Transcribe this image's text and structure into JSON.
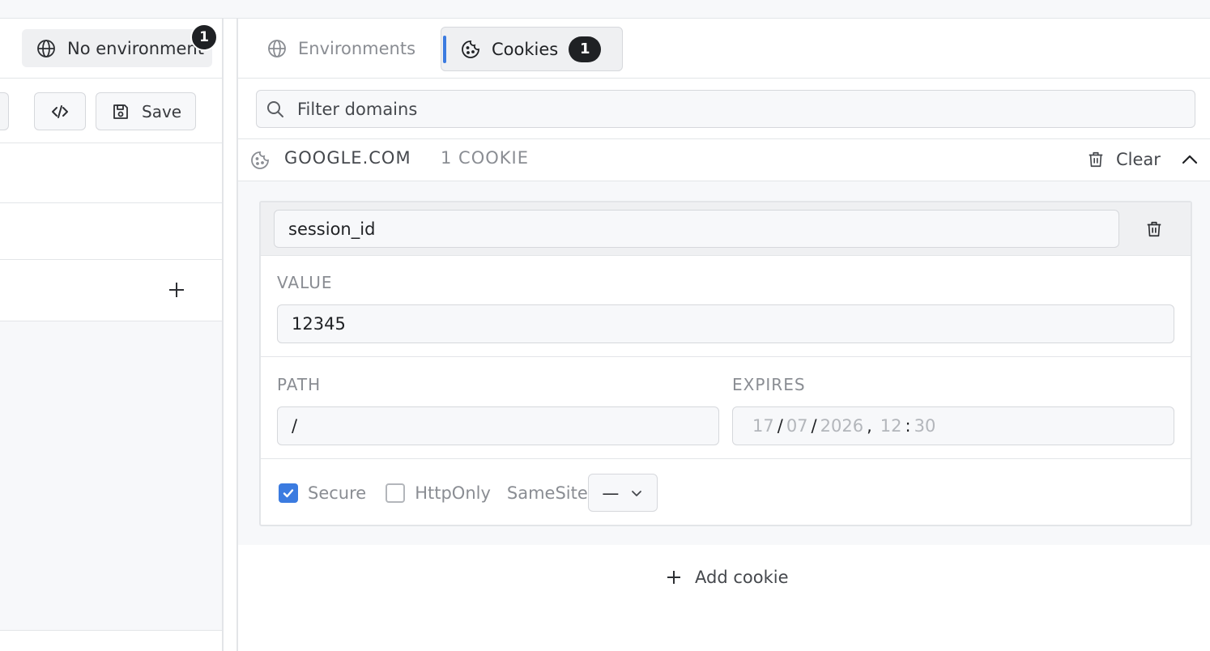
{
  "environment": {
    "label": "No environment",
    "badge": "1"
  },
  "toolbar": {
    "save_label": "Save"
  },
  "tabs": [
    {
      "label": "Environments",
      "active": false
    },
    {
      "label": "Cookies",
      "active": true,
      "badge": "1"
    }
  ],
  "filter": {
    "placeholder": "Filter domains"
  },
  "domain": {
    "name": "GOOGLE.COM",
    "count": "1 COOKIE",
    "clear_label": "Clear"
  },
  "cookie": {
    "name": "session_id",
    "value_label": "VALUE",
    "value": "12345",
    "path_label": "PATH",
    "path": "/",
    "expires_label": "EXPIRES",
    "expires": {
      "day": "17",
      "month": "07",
      "year": "2026",
      "hour": "12",
      "minute": "30"
    },
    "secure_label": "Secure",
    "secure": true,
    "httponly_label": "HttpOnly",
    "httponly": false,
    "samesite_label": "SameSite",
    "samesite_value": "—"
  },
  "add_cookie_label": "Add cookie",
  "colors": {
    "accent": "#3b7be0",
    "badge": "#1f2124"
  }
}
